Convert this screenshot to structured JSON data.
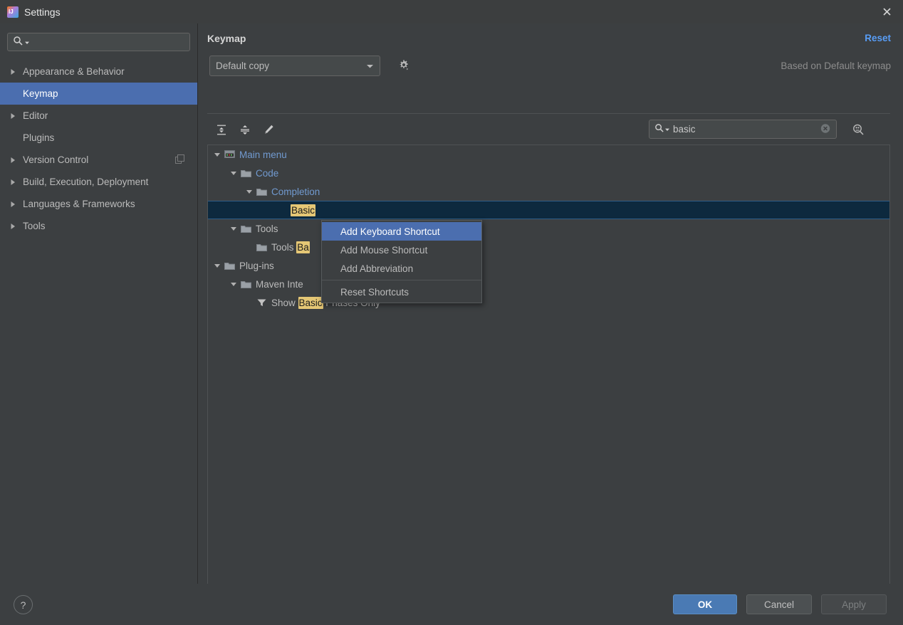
{
  "window": {
    "title": "Settings",
    "app_icon": "intellij-idea-icon",
    "close_icon": "close-icon"
  },
  "sidebar": {
    "search": {
      "placeholder": "",
      "value": "",
      "icon": "search-icon"
    },
    "items": [
      {
        "label": "Appearance & Behavior",
        "expandable": true,
        "selected": false,
        "trailing_icon": ""
      },
      {
        "label": "Keymap",
        "expandable": false,
        "selected": true,
        "trailing_icon": ""
      },
      {
        "label": "Editor",
        "expandable": true,
        "selected": false,
        "trailing_icon": ""
      },
      {
        "label": "Plugins",
        "expandable": false,
        "selected": false,
        "trailing_icon": ""
      },
      {
        "label": "Version Control",
        "expandable": true,
        "selected": false,
        "trailing_icon": "copy-icon"
      },
      {
        "label": "Build, Execution, Deployment",
        "expandable": true,
        "selected": false,
        "trailing_icon": ""
      },
      {
        "label": "Languages & Frameworks",
        "expandable": true,
        "selected": false,
        "trailing_icon": ""
      },
      {
        "label": "Tools",
        "expandable": true,
        "selected": false,
        "trailing_icon": ""
      }
    ]
  },
  "pane": {
    "title": "Keymap",
    "reset_label": "Reset",
    "keymap_selected": "Default copy",
    "based_on": "Based on Default keymap",
    "gear_icon": "gear-icon",
    "chevron_icon": "chevron-down-icon"
  },
  "toolbar": {
    "expand_all_title": "Expand All",
    "collapse_all_title": "Collapse All",
    "edit_shortcut_title": "Edit Shortcut",
    "expand_all_icon": "expand-all-icon",
    "collapse_all_icon": "collapse-all-icon",
    "edit_icon": "pencil-icon",
    "find_shortcut_icon": "find-by-shortcut-icon"
  },
  "search": {
    "value": "basic",
    "placeholder": "",
    "icon": "search-icon",
    "clear_icon": "clear-icon"
  },
  "tree": {
    "highlight_term": "basic",
    "rows": [
      {
        "indent": 0,
        "arrow": "down",
        "icon": "main-menu-icon",
        "pre": "Main menu",
        "hl": "",
        "post": "",
        "style": "link"
      },
      {
        "indent": 1,
        "arrow": "down",
        "icon": "folder-icon",
        "pre": "Code",
        "hl": "",
        "post": "",
        "style": "link"
      },
      {
        "indent": 2,
        "arrow": "down",
        "icon": "folder-icon",
        "pre": "Completion",
        "hl": "",
        "post": "",
        "style": "link"
      },
      {
        "indent": 3,
        "arrow": "none",
        "icon": "none",
        "pre": "",
        "hl": "Basic",
        "post": "",
        "style": "plain",
        "selected": true
      },
      {
        "indent": 1,
        "arrow": "down",
        "icon": "folder-icon",
        "pre": "Tools",
        "hl": "",
        "post": "",
        "style": "plain"
      },
      {
        "indent": 2,
        "arrow": "none",
        "icon": "folder-icon",
        "pre": "Tools ",
        "hl": "Ba",
        "post": "",
        "style": "plain"
      },
      {
        "indent": 0,
        "arrow": "down",
        "icon": "folder-icon",
        "pre": "Plug-ins",
        "hl": "",
        "post": "",
        "style": "plain"
      },
      {
        "indent": 1,
        "arrow": "down",
        "icon": "folder-icon",
        "pre": "Maven Inte",
        "hl": "",
        "post": "",
        "style": "plain"
      },
      {
        "indent": 2,
        "arrow": "none",
        "icon": "filter-icon",
        "pre": "Show ",
        "hl": "Basic",
        "post": " Phases Only",
        "style": "plain"
      }
    ]
  },
  "context_menu": {
    "items": [
      {
        "label": "Add Keyboard Shortcut",
        "highlighted": true
      },
      {
        "label": "Add Mouse Shortcut",
        "highlighted": false
      },
      {
        "label": "Add Abbreviation",
        "highlighted": false
      },
      {
        "separator_before": true,
        "label": "Reset Shortcuts",
        "highlighted": false
      }
    ]
  },
  "footer": {
    "help_label": "?",
    "ok_label": "OK",
    "cancel_label": "Cancel",
    "apply_label": "Apply"
  },
  "colors": {
    "accent": "#4b6eaf",
    "link": "#589df6",
    "tree_link": "#719ad0",
    "highlight_bg": "#e5c775",
    "selection_row": "#0d293e",
    "background": "#3c3f41"
  }
}
